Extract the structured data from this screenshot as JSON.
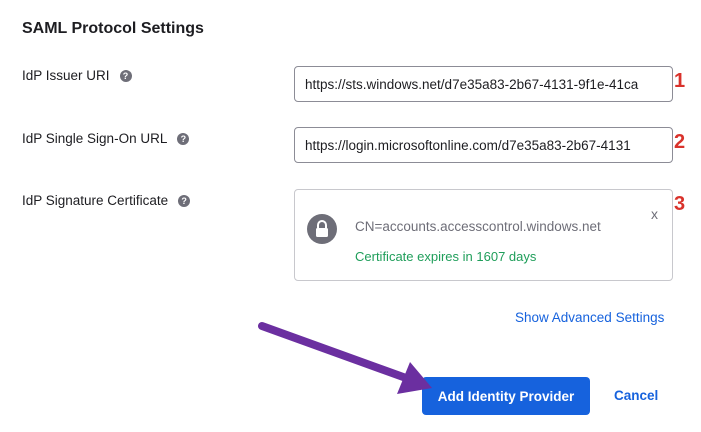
{
  "section": {
    "title": "SAML Protocol Settings"
  },
  "fields": {
    "issuer": {
      "label": "IdP Issuer URI",
      "value": "https://sts.windows.net/d7e35a83-2b67-4131-9f1e-41ca",
      "badge": "1"
    },
    "sso": {
      "label": "IdP Single Sign-On URL",
      "value": "https://login.microsoftonline.com/d7e35a83-2b67-4131",
      "badge": "2"
    },
    "certificate": {
      "label": "IdP Signature Certificate",
      "cn": "CN=accounts.accesscontrol.windows.net",
      "expires": "Certificate expires in 1607 days",
      "close": "x",
      "badge": "3"
    }
  },
  "help_icon": "?",
  "links": {
    "advanced": "Show Advanced Settings"
  },
  "actions": {
    "add": "Add Identity Provider",
    "cancel": "Cancel"
  },
  "colors": {
    "accent": "#1662dd",
    "success": "#1f9e5a",
    "badge": "#d9322b",
    "arrow": "#6b2fa0"
  },
  "icons": {
    "help": "question-circle-icon",
    "lock": "lock-icon",
    "close": "close-icon",
    "arrow": "arrow-annotation-icon"
  }
}
